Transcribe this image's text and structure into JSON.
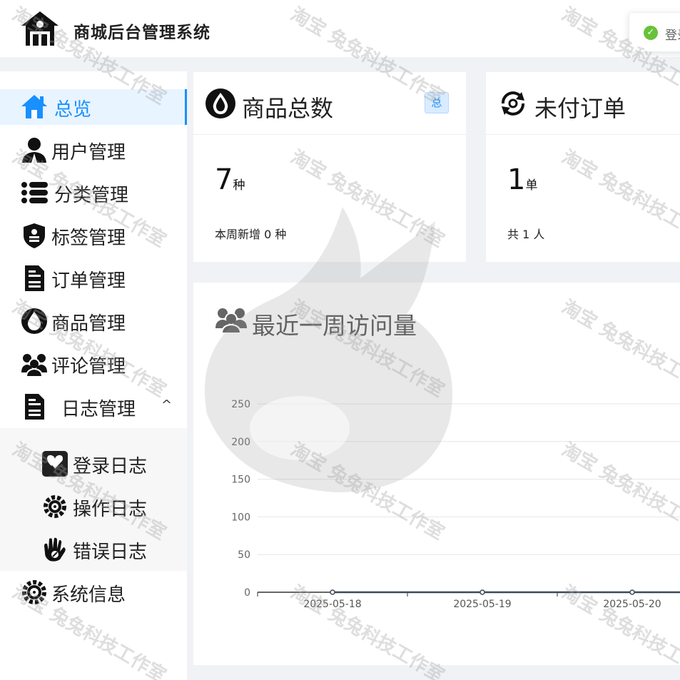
{
  "app": {
    "title": "商城后台管理系统"
  },
  "toast": {
    "message": "登录成功"
  },
  "sidebar": {
    "items": [
      {
        "label": "总览",
        "icon": "home-icon",
        "active": true
      },
      {
        "label": "用户管理",
        "icon": "user-icon"
      },
      {
        "label": "分类管理",
        "icon": "list-icon"
      },
      {
        "label": "标签管理",
        "icon": "tag-shield-icon"
      },
      {
        "label": "订单管理",
        "icon": "document-icon"
      },
      {
        "label": "商品管理",
        "icon": "drop-icon"
      },
      {
        "label": "评论管理",
        "icon": "group-icon"
      },
      {
        "label": "日志管理",
        "icon": "document-icon",
        "expanded": true
      },
      {
        "label": "系统信息",
        "icon": "gear-icon"
      }
    ],
    "log_children": [
      {
        "label": "登录日志",
        "icon": "heart-check-icon"
      },
      {
        "label": "操作日志",
        "icon": "gear-icon"
      },
      {
        "label": "错误日志",
        "icon": "hand-icon"
      }
    ]
  },
  "cards": {
    "products": {
      "title": "商品总数",
      "badge": "总",
      "value": "7",
      "unit": "种",
      "note": "本周新增 0 种"
    },
    "orders": {
      "title": "未付订单",
      "value": "1",
      "unit": "单",
      "note": "共 1 人"
    }
  },
  "visits": {
    "title": "最近一周访问量"
  },
  "chart_data": {
    "type": "line",
    "x": [
      "2025-05-18",
      "2025-05-19",
      "2025-05-20"
    ],
    "series": [
      {
        "values": [
          0,
          0,
          0
        ]
      }
    ],
    "ylim": [
      0,
      250
    ],
    "yticks": [
      "0",
      "50",
      "100",
      "150",
      "200",
      "250"
    ],
    "grid": true,
    "colors": {
      "line": "#3b4a5a",
      "grid": "#e6e6e6"
    }
  },
  "watermark": "淘宝 兔兔科技工作室"
}
